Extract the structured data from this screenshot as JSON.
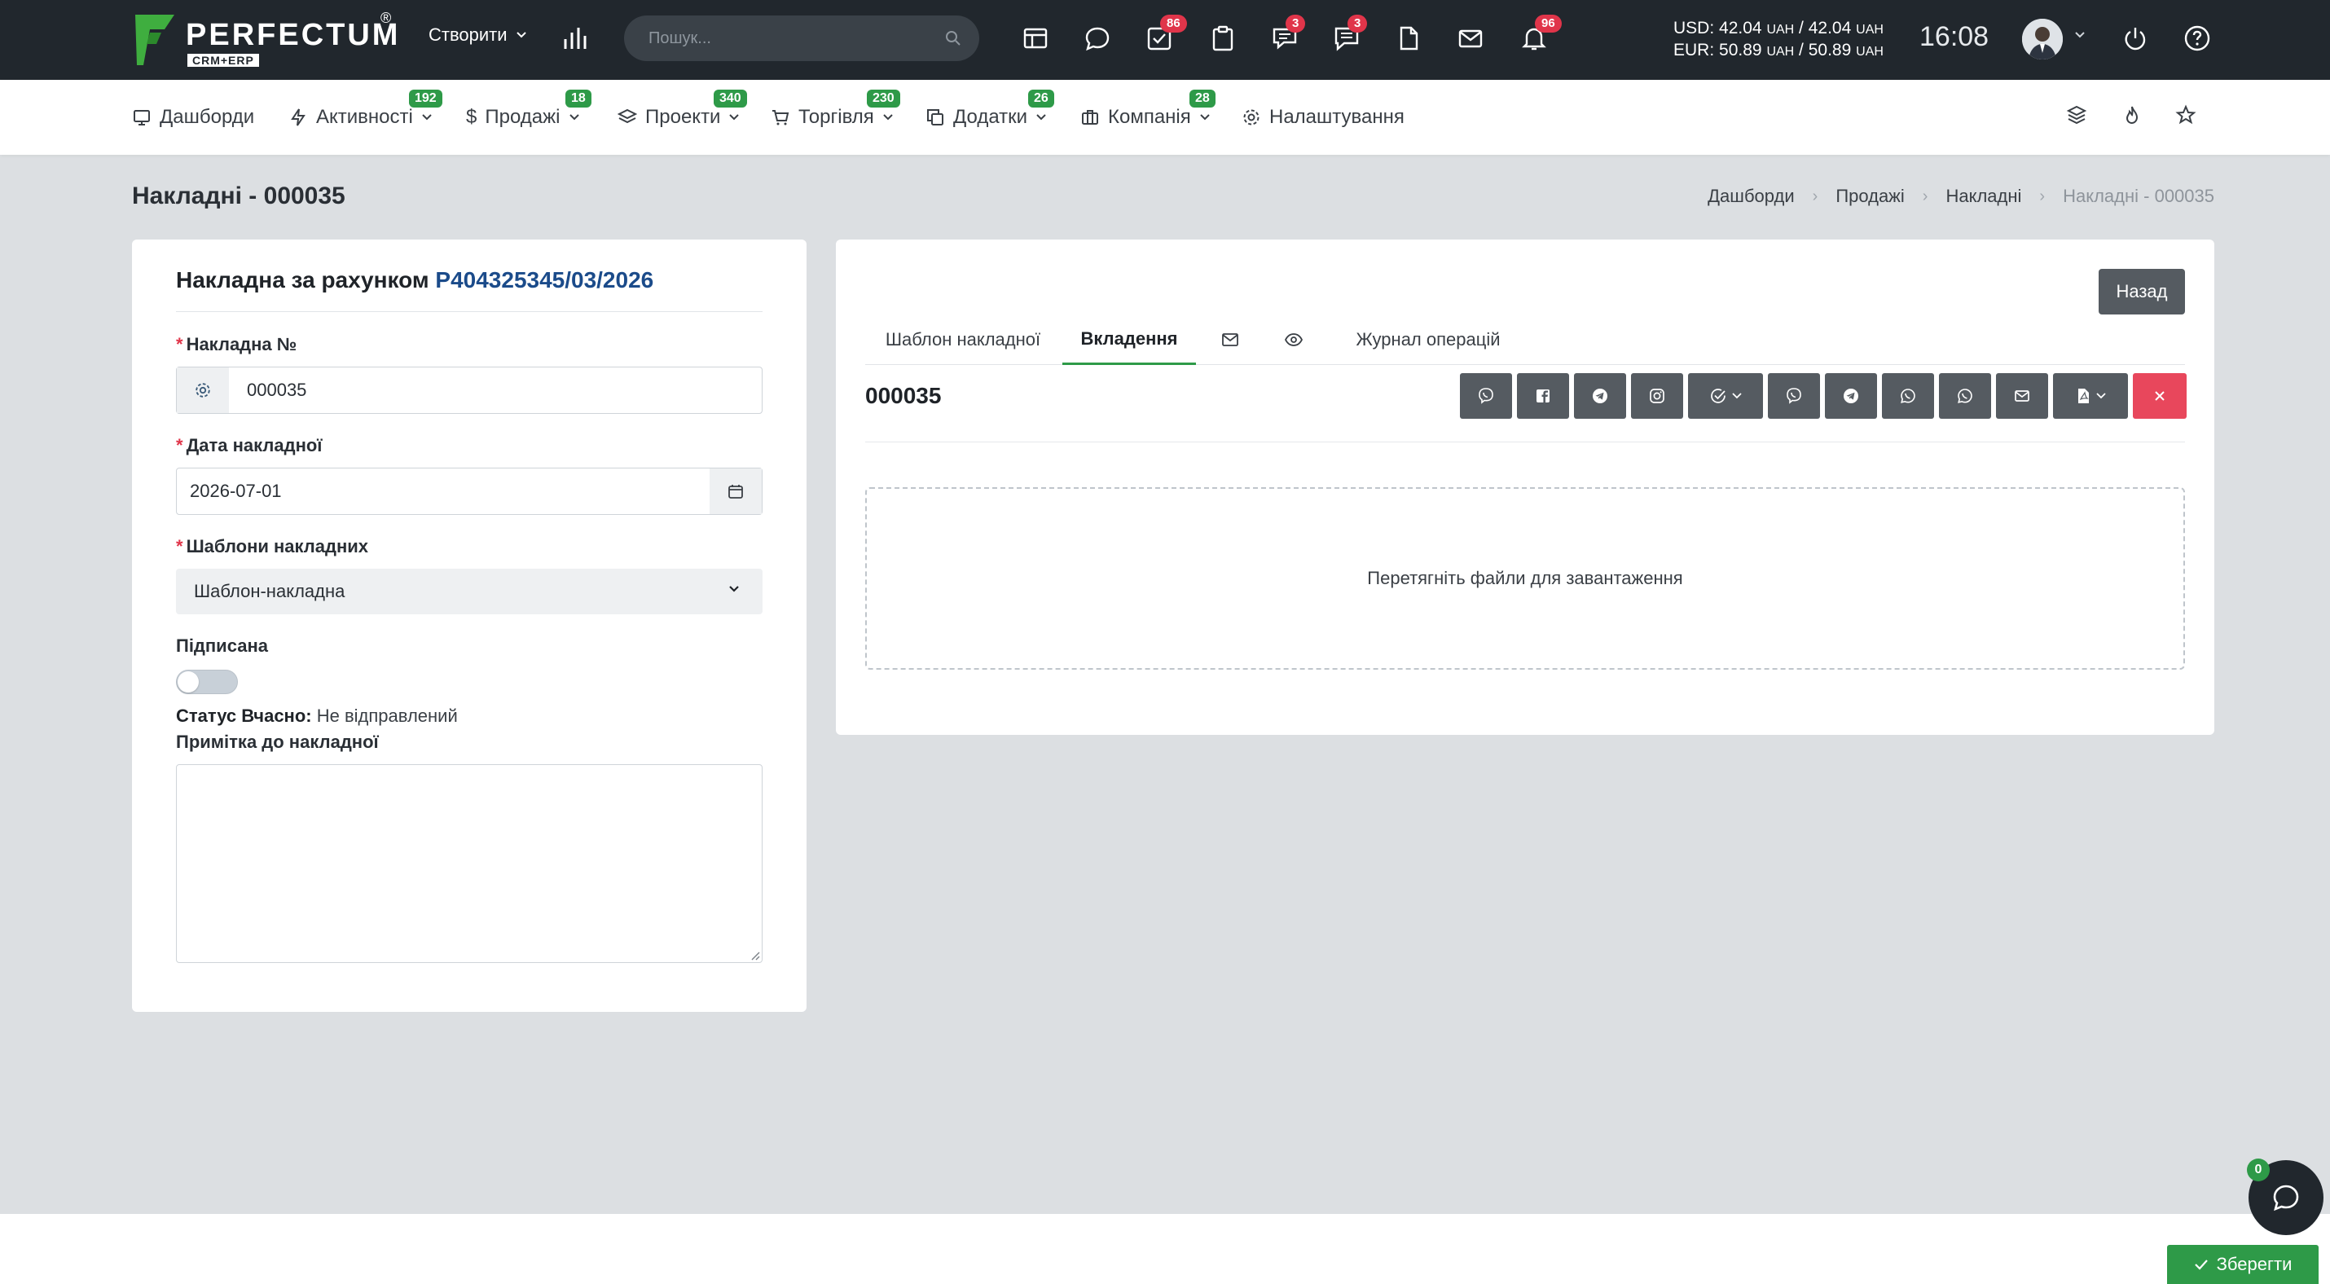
{
  "topbar": {
    "logo_text": "PERFECTUM",
    "logo_sub": "CRM+ERP",
    "logo_reg": "®",
    "create_label": "Створити",
    "search_placeholder": "Пошук...",
    "icons": [
      {
        "name": "calendar-table-icon",
        "badge": ""
      },
      {
        "name": "chat-bubble-icon",
        "badge": ""
      },
      {
        "name": "task-check-icon",
        "badge": "86"
      },
      {
        "name": "clipboard-icon",
        "badge": ""
      },
      {
        "name": "comments-icon",
        "badge": "3"
      },
      {
        "name": "messages-icon",
        "badge": "3"
      },
      {
        "name": "document-icon",
        "badge": ""
      },
      {
        "name": "mail-icon",
        "badge": ""
      },
      {
        "name": "bell-icon",
        "badge": "96"
      }
    ],
    "rates": {
      "usd_label": "USD:",
      "usd_buy": "42.04",
      "usd_sell": "42.04",
      "unit": "UAH",
      "eur_label": "EUR:",
      "eur_buy": "50.89",
      "eur_sell": "50.89"
    },
    "clock": "16:08"
  },
  "nav": {
    "items": [
      {
        "label": "Дашборди",
        "badge": ""
      },
      {
        "label": "Активності",
        "badge": "192"
      },
      {
        "label": "Продажі",
        "badge": "18"
      },
      {
        "label": "Проекти",
        "badge": "340"
      },
      {
        "label": "Торгівля",
        "badge": "230"
      },
      {
        "label": "Додатки",
        "badge": "26"
      },
      {
        "label": "Компанія",
        "badge": "28"
      },
      {
        "label": "Налаштування",
        "badge": ""
      }
    ]
  },
  "page": {
    "title": "Накладні - 000035",
    "breadcrumb": [
      "Дашборди",
      "Продажі",
      "Накладні",
      "Накладні - 000035"
    ]
  },
  "form": {
    "heading_prefix": "Накладна за рахунком",
    "invoice_link": "P404325345/03/2026",
    "number_label": "Накладна №",
    "number_value": "000035",
    "date_label": "Дата накладної",
    "date_value": "2026-07-01",
    "template_label": "Шаблони накладних",
    "template_value": "Шаблон-накладна",
    "signed_label": "Підписана",
    "signed": false,
    "status_label": "Статус Вчасно:",
    "status_value": "Не відправлений",
    "note_label": "Примітка до накладної",
    "note_value": ""
  },
  "right": {
    "back_label": "Назад",
    "tabs": [
      "Шаблон накладної",
      "Вкладення",
      "",
      "",
      "Журнал операцій"
    ],
    "active_tab": "Вкладення",
    "doc_number": "000035",
    "dropzone_text": "Перетягніть файли для завантаження"
  },
  "footer": {
    "save_label": "Зберегти",
    "chat_badge": "0"
  },
  "colors": {
    "topbar": "#21272d",
    "accent_green": "#2e9a48",
    "badge_red": "#e0354a",
    "link_blue": "#1b4b8a",
    "button_gray": "#555b61",
    "danger": "#e8475c"
  }
}
